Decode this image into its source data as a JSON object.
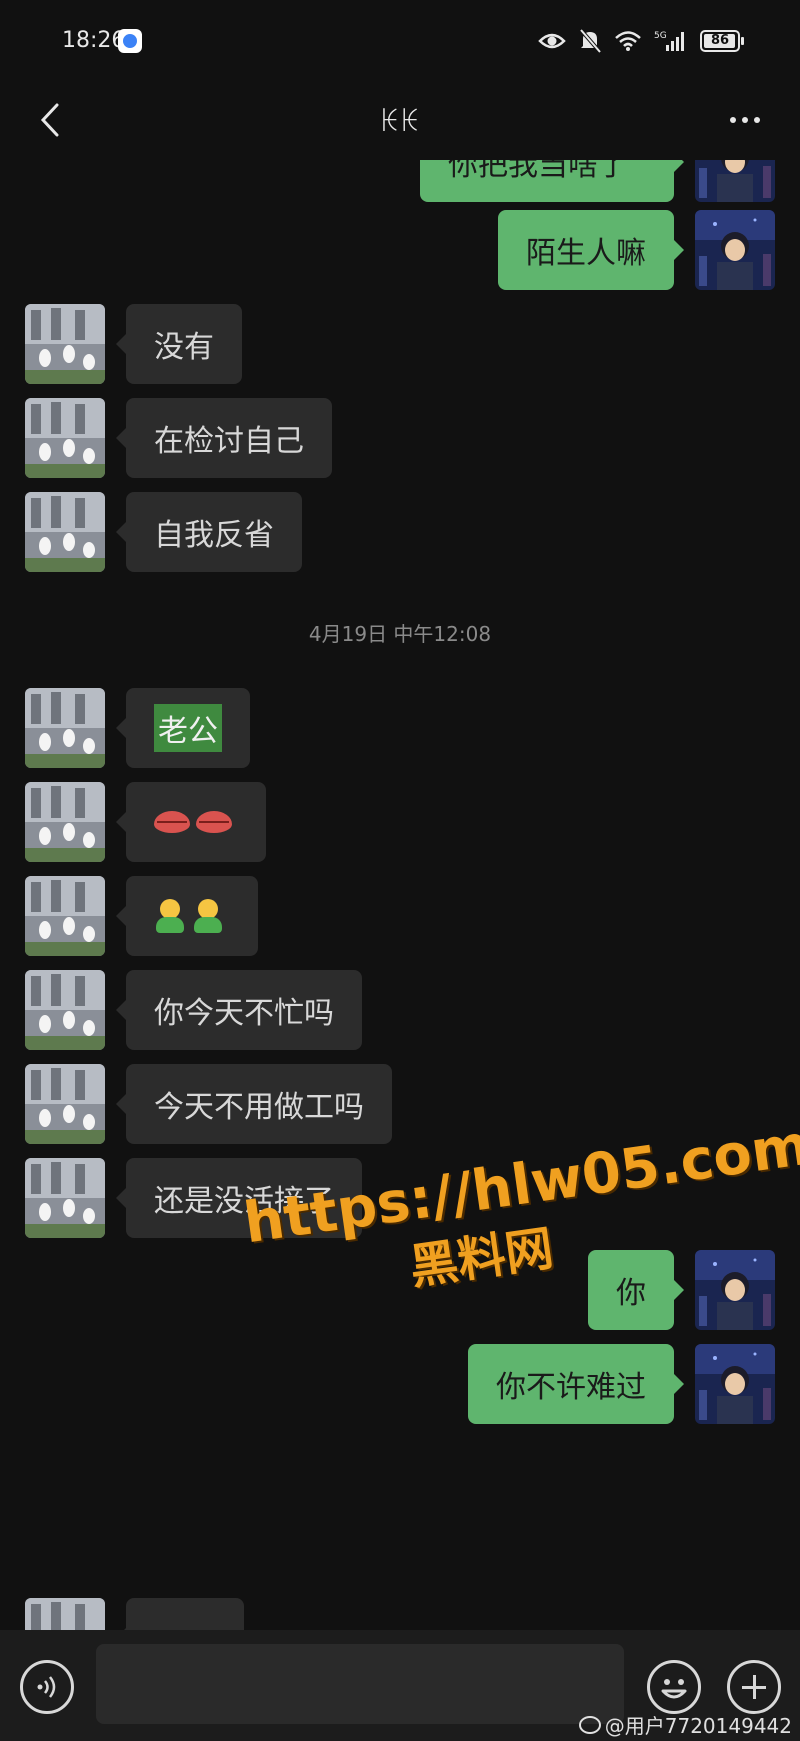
{
  "status_bar": {
    "time": "18:26",
    "network": "5G",
    "battery_level": "86"
  },
  "header": {
    "title": "ꀘꀘ"
  },
  "messages": [
    {
      "side": "right",
      "text": "你把我当啥了"
    },
    {
      "side": "right",
      "text": "陌生人嘛"
    },
    {
      "side": "left",
      "text": "没有"
    },
    {
      "side": "left",
      "text": "在检讨自己"
    },
    {
      "side": "left",
      "text": "自我反省"
    },
    {
      "side": "left",
      "text": "老公"
    },
    {
      "side": "left",
      "emoji": "kissing-lips-icon"
    },
    {
      "side": "left",
      "emoji": "people-icon"
    },
    {
      "side": "left",
      "text": "你今天不忙吗"
    },
    {
      "side": "left",
      "text": "今天不用做工吗"
    },
    {
      "side": "left",
      "text": "还是没活接了"
    },
    {
      "side": "right",
      "text": "你"
    },
    {
      "side": "right",
      "text": "你不许难过"
    }
  ],
  "timestamp": "4月19日 中午12:08",
  "watermark": {
    "url": "https://hlw05.com",
    "name": "黑料网"
  },
  "footer": {
    "credit": "@用户7720149442"
  },
  "colors": {
    "background": "#111111",
    "outgoing_bubble": "#5fb56e",
    "incoming_bubble": "#2c2c2c",
    "watermark": "#f0a020"
  }
}
